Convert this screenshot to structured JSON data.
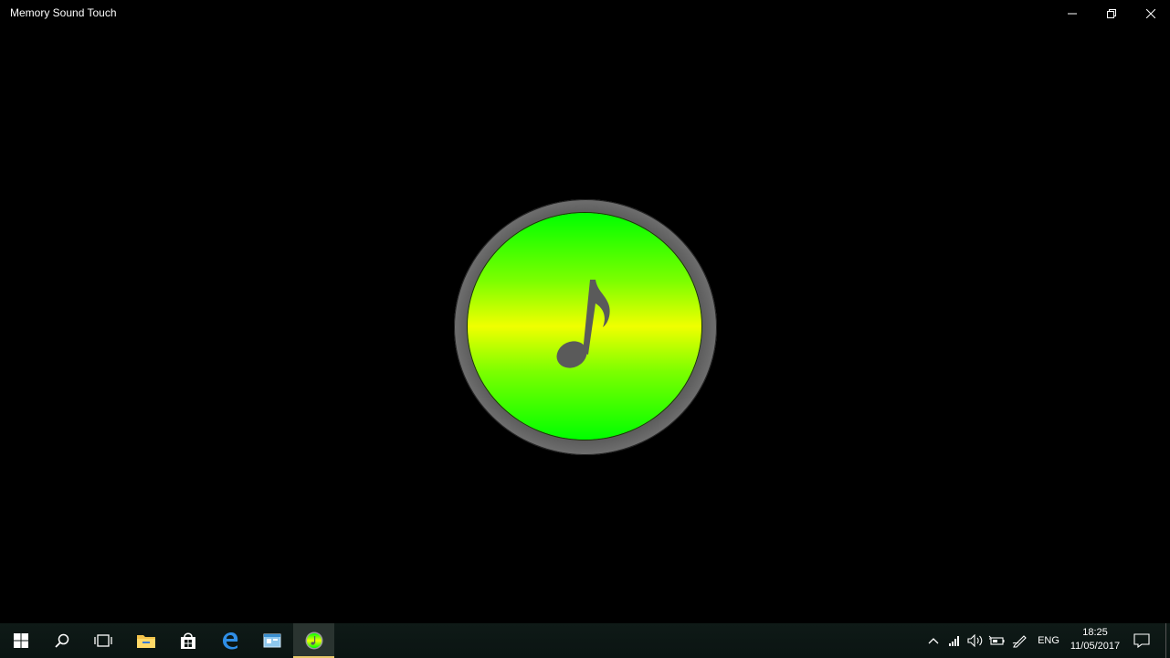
{
  "window": {
    "title": "Memory Sound Touch",
    "controls": {
      "minimize_icon": "minimize-icon",
      "restore_icon": "restore-icon",
      "close_icon": "close-icon"
    }
  },
  "main": {
    "sound_button": {
      "icon": "music-note-icon",
      "gradient_colors": [
        "#00ff00",
        "#f0ff00"
      ],
      "ring_color": "#9a9a9a",
      "note_color": "#5a5a5a"
    }
  },
  "taskbar": {
    "apps": [
      {
        "name": "start",
        "icon": "windows-logo-icon"
      },
      {
        "name": "search",
        "icon": "search-icon"
      },
      {
        "name": "task-view",
        "icon": "task-view-icon"
      },
      {
        "name": "file-explorer",
        "icon": "folder-icon"
      },
      {
        "name": "store",
        "icon": "store-icon"
      },
      {
        "name": "edge",
        "icon": "edge-icon"
      },
      {
        "name": "app",
        "icon": "app-window-icon"
      },
      {
        "name": "memory-sound-touch",
        "icon": "memory-sound-touch-app-icon",
        "active": true
      }
    ],
    "tray": {
      "chevron": "chevron-up-icon",
      "network": "network-icon",
      "volume": "volume-icon",
      "battery": "battery-icon",
      "pen": "pen-icon",
      "language": "ENG",
      "notifications": "notification-icon"
    },
    "clock": {
      "time": "18:25",
      "date": "11/05/2017"
    },
    "accent_color": "#e8c86a"
  }
}
